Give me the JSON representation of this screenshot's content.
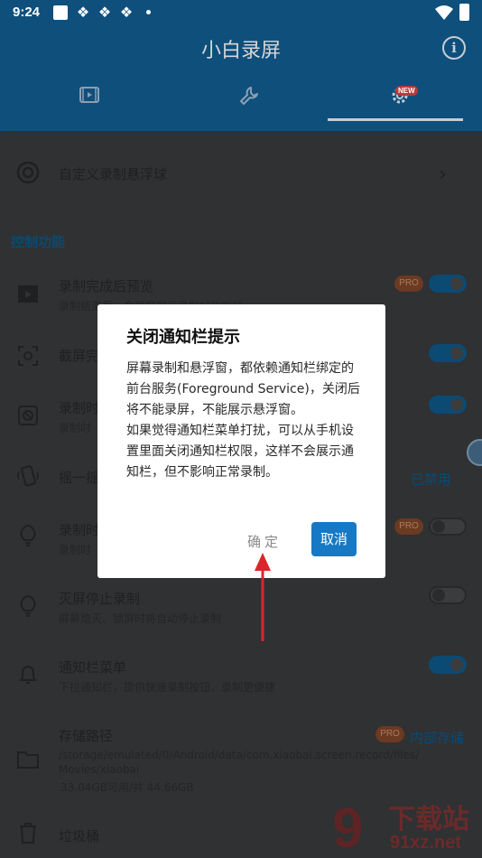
{
  "status_bar": {
    "time": "9:24"
  },
  "header": {
    "title": "小白录屏",
    "tabs": [
      "video-tab",
      "tools-tab",
      "settings-tab"
    ],
    "new_badge": "NEW"
  },
  "rows": {
    "custom_ball": {
      "title": "自定义录制悬浮球"
    },
    "section_title": "控制功能",
    "preview": {
      "title": "录制完成后预览",
      "sub": "录制结束后，会弹窗展示录制好的视频"
    },
    "screenshot": {
      "title": "截屏完"
    },
    "record_hide": {
      "title": "录制时",
      "sub": "录制时"
    },
    "shake": {
      "title": "摇一摇",
      "status": "已禁用"
    },
    "record_light": {
      "title": "录制时",
      "sub": "录制时"
    },
    "screen_off": {
      "title": "灭屏停止录制",
      "sub": "屏幕熄灭、锁屏时将自动停止录制"
    },
    "notification": {
      "title": "通知栏菜单",
      "sub": "下拉通知栏，提供快速录制按钮，录制更便捷"
    },
    "storage": {
      "title": "存储路径",
      "path": "/storage/emulated/0/Android/data/com.xiaobai.screen.record/files/\nMovies/xiaobai",
      "space": "33.04GB可用/共 44.66GB",
      "location": "内部存储"
    },
    "trash": {
      "title": "垃圾桶"
    },
    "pro_label": "PRO"
  },
  "dialog": {
    "title": "关闭通知栏提示",
    "body": "屏幕录制和悬浮窗，都依赖通知栏绑定的前台服务(Foreground Service)，关闭后将不能录屏，不能展示悬浮窗。\n如果觉得通知栏菜单打扰，可以从手机设置里面关闭通知栏权限，这样不会展示通知栏，但不影响正常录制。",
    "confirm": "确定",
    "cancel": "取消"
  },
  "watermark": {
    "text": "下载站",
    "url": "91xz.net"
  },
  "colors": {
    "accent": "#1679c5",
    "header": "#0f4f7c",
    "annotation_arrow": "#d9262c"
  }
}
